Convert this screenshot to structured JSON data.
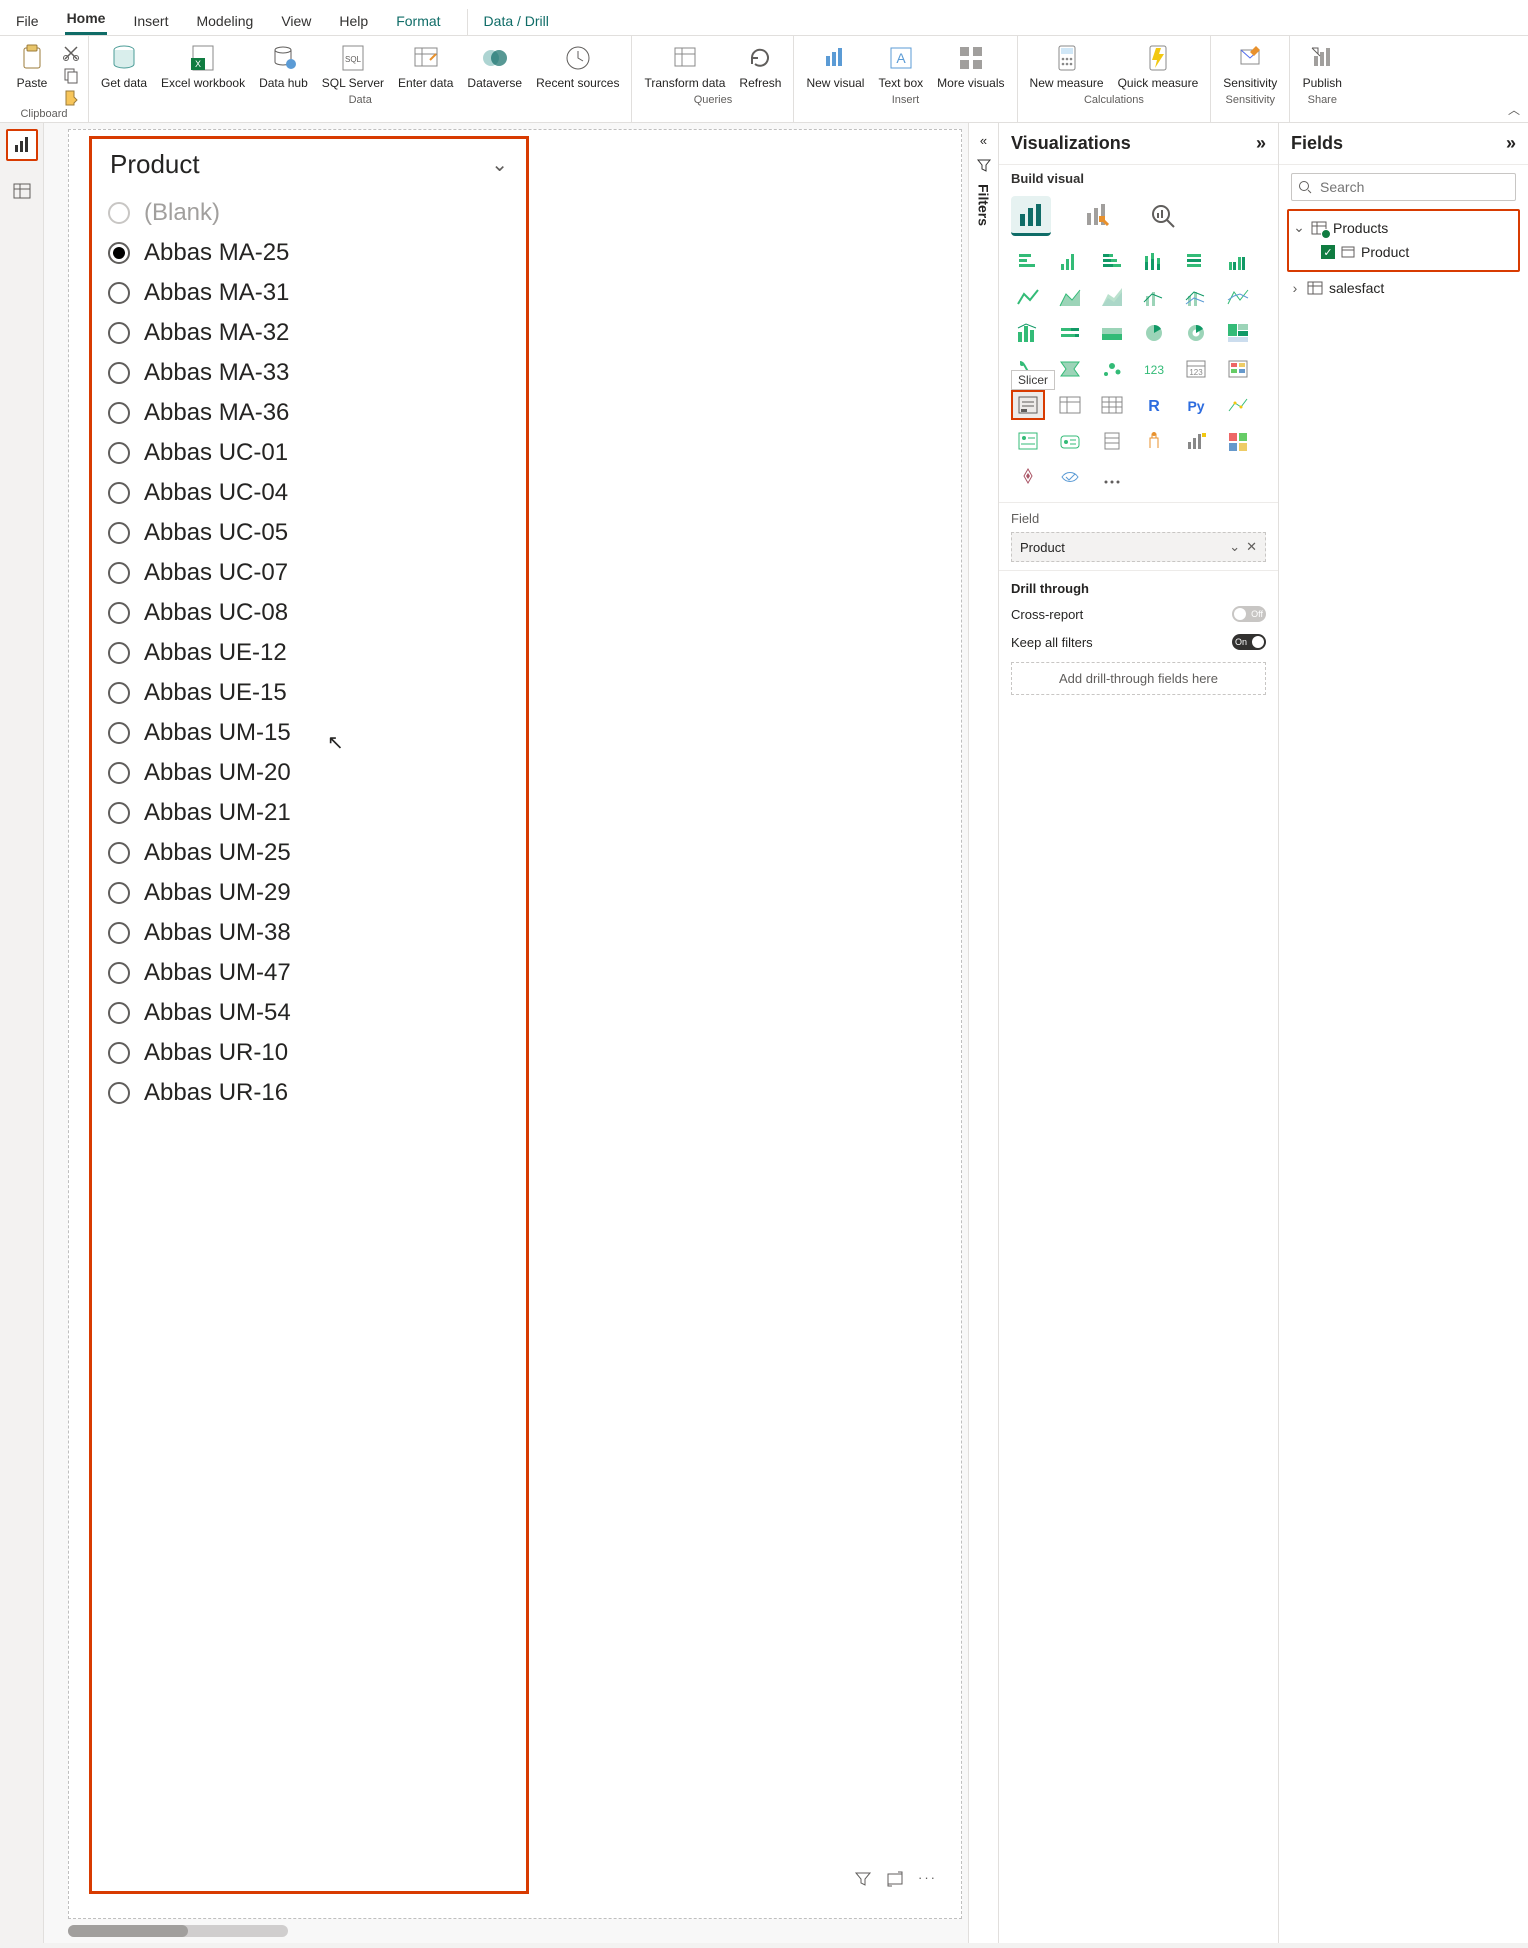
{
  "ribbon": {
    "tabs": [
      "File",
      "Home",
      "Insert",
      "Modeling",
      "View",
      "Help",
      "Format",
      "Data / Drill"
    ],
    "active_tab": "Home",
    "groups": {
      "clipboard": {
        "label": "Clipboard",
        "paste": "Paste"
      },
      "data": {
        "label": "Data",
        "get_data": "Get data",
        "excel_workbook": "Excel workbook",
        "data_hub": "Data hub",
        "sql_server": "SQL Server",
        "enter_data": "Enter data",
        "dataverse": "Dataverse",
        "recent_sources": "Recent sources"
      },
      "queries": {
        "label": "Queries",
        "transform_data": "Transform data",
        "refresh": "Refresh"
      },
      "insert": {
        "label": "Insert",
        "new_visual": "New visual",
        "text_box": "Text box",
        "more_visuals": "More visuals"
      },
      "calculations": {
        "label": "Calculations",
        "new_measure": "New measure",
        "quick_measure": "Quick measure"
      },
      "sensitivity": {
        "label": "Sensitivity",
        "sensitivity": "Sensitivity"
      },
      "share": {
        "label": "Share",
        "publish": "Publish"
      }
    }
  },
  "slicer": {
    "title": "Product",
    "selected_index": 1,
    "items": [
      "(Blank)",
      "Abbas MA-25",
      "Abbas MA-31",
      "Abbas MA-32",
      "Abbas MA-33",
      "Abbas MA-36",
      "Abbas UC-01",
      "Abbas UC-04",
      "Abbas UC-05",
      "Abbas UC-07",
      "Abbas UC-08",
      "Abbas UE-12",
      "Abbas UE-15",
      "Abbas UM-15",
      "Abbas UM-20",
      "Abbas UM-21",
      "Abbas UM-25",
      "Abbas UM-29",
      "Abbas UM-38",
      "Abbas UM-47",
      "Abbas UM-54",
      "Abbas UR-10",
      "Abbas UR-16"
    ]
  },
  "visualizations": {
    "title": "Visualizations",
    "subtitle": "Build visual",
    "slicer_tooltip": "Slicer",
    "field_well_label": "Field",
    "field_value": "Product",
    "drill": {
      "title": "Drill through",
      "cross_report": "Cross-report",
      "cross_report_state": "Off",
      "keep_filters": "Keep all filters",
      "keep_filters_state": "On",
      "drop_hint": "Add drill-through fields here"
    }
  },
  "fields": {
    "title": "Fields",
    "search_placeholder": "Search",
    "tables": [
      {
        "name": "Products",
        "expanded": true,
        "columns": [
          {
            "name": "Product",
            "checked": true
          }
        ]
      },
      {
        "name": "salesfact",
        "expanded": false,
        "columns": []
      }
    ]
  },
  "filters_label": "Filters"
}
